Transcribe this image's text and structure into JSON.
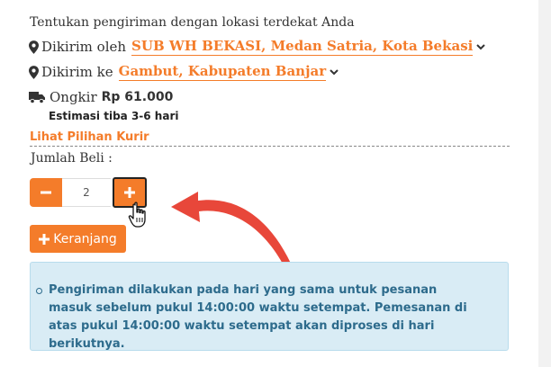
{
  "shipping": {
    "hint": "Tentukan pengiriman dengan lokasi terdekat Anda",
    "from_label": "Dikirim oleh",
    "from_value": "SUB WH BEKASI, Medan Satria, Kota Bekasi",
    "to_label": "Dikirim ke",
    "to_value": "Gambut, Kabupaten Banjar",
    "ongkir_label": "Ongkir",
    "ongkir_value": "Rp 61.000",
    "estimasi": "Estimasi tiba 3-6 hari",
    "courier_link": "Lihat Pilihan Kurir"
  },
  "quantity": {
    "label": "Jumlah Beli :",
    "minus": "−",
    "value": "2",
    "plus": "+"
  },
  "cart": {
    "label": "Keranjang"
  },
  "info": {
    "text": "Pengiriman dilakukan pada hari yang sama untuk pesanan masuk sebelum pukul 14:00:00 waktu setempat. Pemesanan di atas pukul 14:00:00 waktu setempat akan diproses di hari berikutnya."
  },
  "colors": {
    "accent": "#f47c2a",
    "info_bg": "#d9ecf5",
    "info_text": "#2d6b8c",
    "arrow": "#e8473a"
  },
  "icons": [
    "map-marker-icon",
    "chevron-down-icon",
    "truck-icon",
    "minus-icon",
    "plus-icon",
    "hand-cursor-icon",
    "curved-arrow-icon"
  ]
}
